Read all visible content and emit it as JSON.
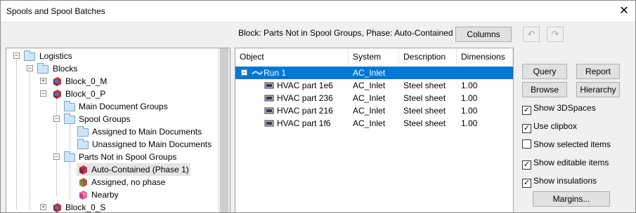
{
  "window": {
    "title": "Spools and Spool Batches"
  },
  "header": {
    "block_label": "Block: Parts Not in Spool Groups, Phase: Auto-Contained",
    "columns_button": "Columns"
  },
  "tree": [
    {
      "label": "Logistics",
      "icon": "folder-icon",
      "expander": "−"
    },
    {
      "label": "Blocks",
      "icon": "folder-icon",
      "expander": "−"
    },
    {
      "label": "Block_0_M",
      "icon": "block-icon",
      "expander": "+"
    },
    {
      "label": "Block_0_P",
      "icon": "block-icon",
      "expander": "−"
    },
    {
      "label": "Main Document Groups",
      "icon": "folder-icon",
      "expander": ""
    },
    {
      "label": "Spool Groups",
      "icon": "folder-icon",
      "expander": "−"
    },
    {
      "label": "Assigned to Main Documents",
      "icon": "folder-icon",
      "expander": ""
    },
    {
      "label": "Unassigned to Main Documents",
      "icon": "folder-icon",
      "expander": ""
    },
    {
      "label": "Parts Not in Spool Groups",
      "icon": "folder-icon",
      "expander": "−"
    },
    {
      "label": "Auto-Contained (Phase 1)",
      "icon": "part-red-icon",
      "expander": ""
    },
    {
      "label": "Assigned, no phase",
      "icon": "part-green-icon",
      "expander": ""
    },
    {
      "label": "Nearby",
      "icon": "part-pink-icon",
      "expander": ""
    },
    {
      "label": "Block_0_S",
      "icon": "block-icon",
      "expander": "+"
    }
  ],
  "table": {
    "headers": [
      "Object",
      "System",
      "Description",
      "Dimensions"
    ],
    "rows": [
      {
        "object": "Run 1",
        "system": "AC_Inlet",
        "description": "",
        "dimensions": "",
        "expander": "−"
      },
      {
        "object": "HVAC part 1e6",
        "system": "AC_Inlet",
        "description": "Steel sheet",
        "dimensions": "1.00"
      },
      {
        "object": "HVAC part 236",
        "system": "AC_Inlet",
        "description": "Steel sheet",
        "dimensions": "1.00"
      },
      {
        "object": "HVAC part 216",
        "system": "AC_Inlet",
        "description": "Steel sheet",
        "dimensions": "1.00"
      },
      {
        "object": "HVAC part 1f6",
        "system": "AC_Inlet",
        "description": "Steel sheet",
        "dimensions": "1.00"
      }
    ]
  },
  "buttons": {
    "query": "Query",
    "report": "Report",
    "browse": "Browse",
    "hierarchy": "Hierarchy",
    "margins": "Margins..."
  },
  "options": [
    {
      "label": "Show 3DSpaces",
      "checked": "✓"
    },
    {
      "label": "Use clipbox",
      "checked": "✓"
    },
    {
      "label": "Show selected items",
      "checked": ""
    },
    {
      "label": "Show editable items",
      "checked": "✓"
    },
    {
      "label": "Show insulations",
      "checked": "✓"
    }
  ],
  "colors": {
    "selection": "#0078d7"
  }
}
